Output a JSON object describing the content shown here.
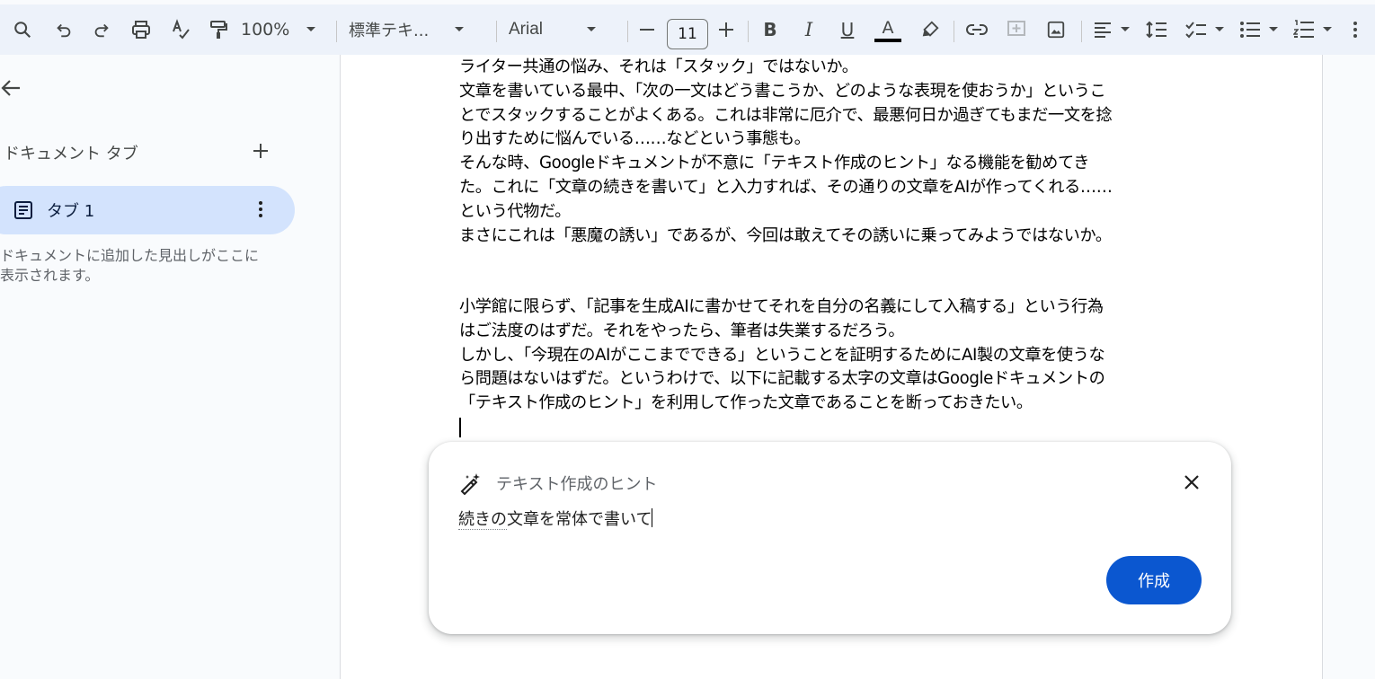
{
  "toolbar": {
    "zoom": "100%",
    "style": "標準テキ...",
    "font": "Arial",
    "font_size": "11",
    "icons": [
      "search-icon",
      "undo-icon",
      "redo-icon",
      "print-icon",
      "spellcheck-icon",
      "paint-format-icon",
      "minus-icon",
      "plus-icon",
      "bold-icon",
      "italic-icon",
      "underline-icon",
      "text-color-icon",
      "highlight-icon",
      "link-icon",
      "comment-icon",
      "image-icon",
      "align-icon",
      "line-spacing-icon",
      "checklist-icon",
      "bullet-list-icon",
      "numbered-list-icon",
      "more-icon"
    ],
    "bold": "B",
    "italic": "I",
    "underline": "U",
    "text_color": "A"
  },
  "sidebar": {
    "tabs_title": "ドキュメント タブ",
    "tab_label": "タブ 1",
    "hint": "ドキュメントに追加した見出しがここに表示されます。"
  },
  "document": {
    "paragraph1_lines": [
      "ライター共通の悩み、それは「スタック」ではないか。",
      "文章を書いている最中、「次の一文はどう書こうか、どのような表現を使おうか」というこ",
      "とでスタックすることがよくある。これは非常に厄介で、最悪何日か過ぎてもまだ一文を捻",
      "り出すために悩んでいる……などという事態も。",
      "そんな時、Googleドキュメントが不意に「テキスト作成のヒント」なる機能を勧めてき",
      "た。これに「文章の続きを書いて」と入力すれば、その通りの文章をAIが作ってくれる……",
      "という代物だ。",
      "まさにこれは「悪魔の誘い」であるが、今回は敢えてその誘いに乗ってみようではないか。"
    ],
    "paragraph2_lines": [
      "小学館に限らず、「記事を生成AIに書かせてそれを自分の名義にして入稿する」という行為",
      "はご法度のはずだ。それをやったら、筆者は失業するだろう。",
      "しかし、「今現在のAIがここまでできる」ということを証明するためにAI製の文章を使うな",
      "ら問題はないはずだ。というわけで、以下に記載する太字の文章はGoogleドキュメントの",
      "「テキスト作成のヒント」を利用して作った文章であることを断っておきたい。"
    ]
  },
  "hint_panel": {
    "title": "テキスト作成のヒント",
    "input_underlined": "続きの",
    "input_rest": "文章を常体で書いて",
    "button": "作成"
  },
  "colors": {
    "toolbar_bg": "#edf2fa",
    "tab_active_bg": "#d3e3fd",
    "create_button": "#0b57d0"
  }
}
